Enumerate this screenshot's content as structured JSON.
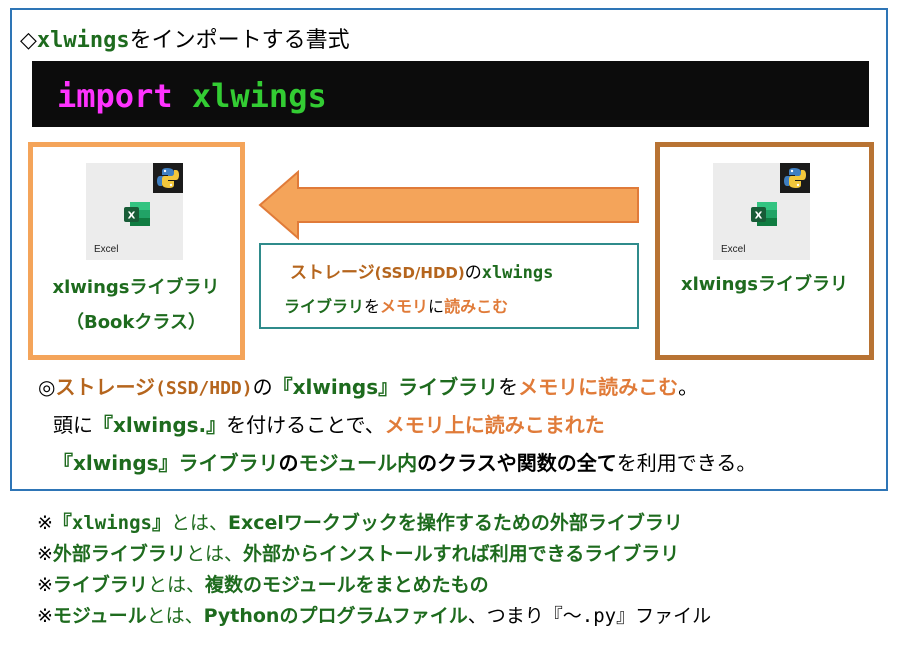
{
  "header": {
    "symbol": "◇",
    "module": "xlwings",
    "suffix": "をインポートする書式"
  },
  "code": {
    "keyword": "import",
    "module": "xlwings"
  },
  "left_panel": {
    "tile_caption": "Excel",
    "label_line1": "xlwingsライブラリ",
    "label_line2": "（Bookクラス）"
  },
  "right_panel": {
    "tile_caption": "Excel",
    "label": "xlwingsライブラリ"
  },
  "storage_box": {
    "l1_a": "ストレージ",
    "l1_b": "(SSD/HDD)",
    "l1_c": "の",
    "l1_d": "xlwings",
    "l2_a": "ライブラリ",
    "l2_b": "を",
    "l2_c": "メモリ",
    "l2_d": "に",
    "l2_e": "読みこむ"
  },
  "explanation": {
    "l1_a": "◎",
    "l1_b": "ストレージ",
    "l1_c": "(SSD/HDD)",
    "l1_d": "の",
    "l1_e": "『xlwings』ライブラリ",
    "l1_f": "を",
    "l1_g": "メモリに読みこむ",
    "l1_h": "。",
    "l2_a": "頭に",
    "l2_b": "『xlwings.』",
    "l2_c": "を付けることで、",
    "l2_d": "メモリ上に読みこまれた",
    "l3_a": "『xlwings』ライブラリ",
    "l3_b": "の",
    "l3_c": "モジュール内",
    "l3_d": "の",
    "l3_e": "クラスや関数の全て",
    "l3_f": "を利用できる。"
  },
  "notes": [
    {
      "a": "※",
      "b": "『xlwings』",
      "c": "とは、",
      "d": "Excelワークブックを操作するための外部ライブラリ"
    },
    {
      "a": "※",
      "b": "外部ライブラリ",
      "c": "とは、",
      "d": "外部からインストールすれば利用できるライブラリ"
    },
    {
      "a": "※",
      "b": "ライブラリ",
      "c": "とは、",
      "d": "複数のモジュールをまとめたもの"
    },
    {
      "a": "※",
      "b": "モジュール",
      "c": "とは、",
      "d": "Pythonのプログラムファイル",
      "e": "、つまり",
      "f": "『～.py』",
      "g": "ファイル"
    }
  ],
  "colors": {
    "frame": "#2e75b6",
    "dark_green": "#1e6b1e",
    "orange": "#e07b39",
    "arrow": "#f4a45a",
    "keyword_magenta": "#ff33ff",
    "keyword_green": "#33cc33"
  },
  "icons": [
    "excel-icon",
    "python-icon",
    "left-arrow-icon"
  ]
}
